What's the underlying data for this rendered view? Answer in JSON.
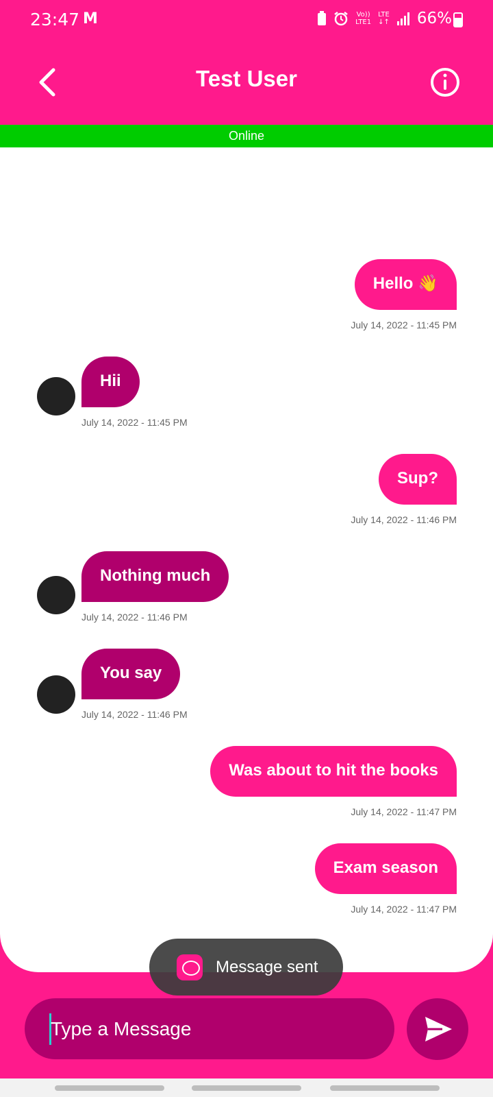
{
  "status_bar": {
    "time": "23:47",
    "carrier_glyph": "M",
    "volte": "Vo))\nLTE1",
    "lte": "LTE\n↓↑",
    "battery": "66%"
  },
  "header": {
    "title": "Test User",
    "status": "Online"
  },
  "messages": [
    {
      "side": "sent",
      "text": "Hello 👋",
      "time": "July 14, 2022 - 11:45 PM"
    },
    {
      "side": "recv",
      "text": "Hii",
      "time": "July 14, 2022 - 11:45 PM"
    },
    {
      "side": "sent",
      "text": "Sup?",
      "time": "July 14, 2022 - 11:46 PM"
    },
    {
      "side": "recv",
      "text": "Nothing much",
      "time": "July 14, 2022 - 11:46 PM"
    },
    {
      "side": "recv",
      "text": "You say",
      "time": "July 14, 2022 - 11:46 PM"
    },
    {
      "side": "sent",
      "text": "Was about to hit the books",
      "time": "July 14, 2022 - 11:47 PM"
    },
    {
      "side": "sent",
      "text": "Exam season",
      "time": "July 14, 2022 - 11:47 PM"
    }
  ],
  "toast": {
    "text": "Message sent"
  },
  "composer": {
    "placeholder": "Type a Message"
  },
  "colors": {
    "primary": "#ff1a8c",
    "received_bubble": "#b0006c",
    "online": "#00cc00"
  }
}
